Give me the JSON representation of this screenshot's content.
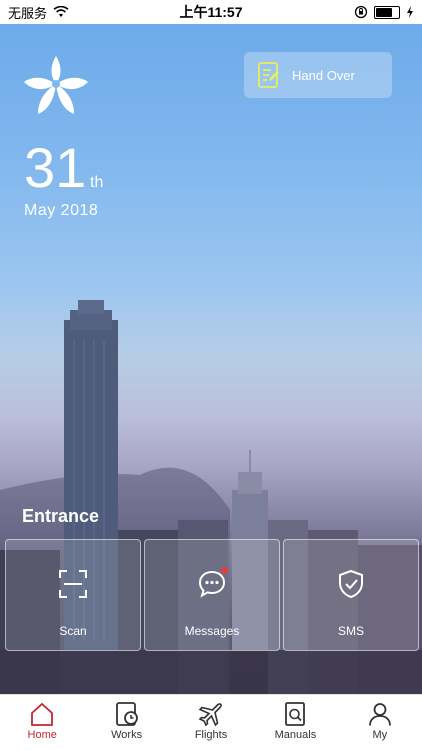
{
  "status_bar": {
    "carrier": "无服务",
    "time": "上午11:57"
  },
  "header": {
    "day": "31",
    "day_suffix": "th",
    "month_year": "May  2018"
  },
  "handover": {
    "label": "Hand Over"
  },
  "entrance": {
    "title": "Entrance",
    "items": [
      {
        "label": "Scan",
        "icon": "scan-icon"
      },
      {
        "label": "Messages",
        "icon": "messages-icon"
      },
      {
        "label": "SMS",
        "icon": "shield-check-icon"
      }
    ]
  },
  "tabbar": {
    "tabs": [
      {
        "label": "Home",
        "icon": "home-icon",
        "active": true
      },
      {
        "label": "Works",
        "icon": "works-icon",
        "active": false
      },
      {
        "label": "Flights",
        "icon": "plane-icon",
        "active": false
      },
      {
        "label": "Manuals",
        "icon": "manuals-icon",
        "active": false
      },
      {
        "label": "My",
        "icon": "user-icon",
        "active": false
      }
    ],
    "active_color": "#c8262c"
  }
}
